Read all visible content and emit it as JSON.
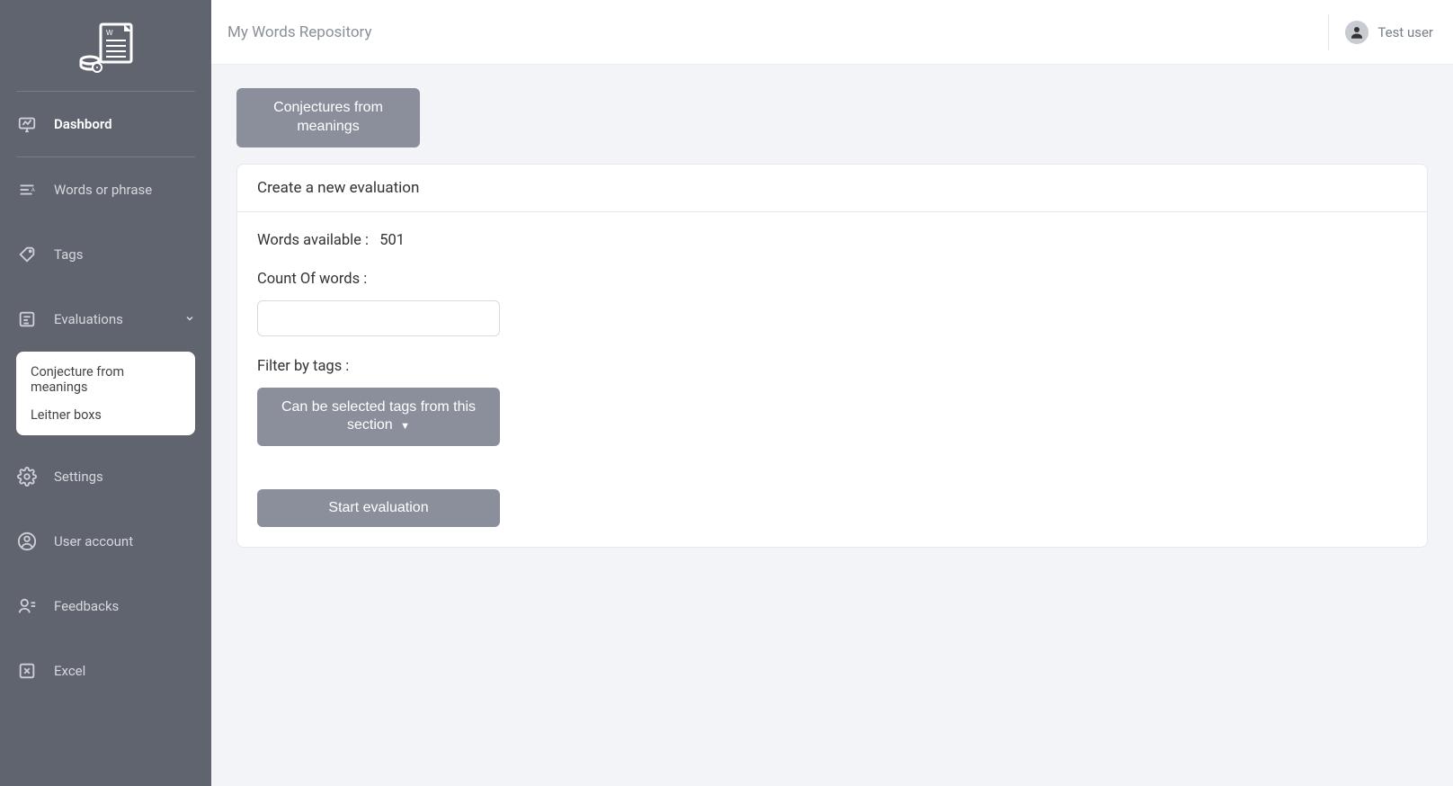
{
  "header": {
    "title": "My Words Repository",
    "user_name": "Test user"
  },
  "sidebar": {
    "items": [
      {
        "label": "Dashbord",
        "icon": "dashboard-icon",
        "active": true
      },
      {
        "label": "Words or phrase",
        "icon": "words-icon"
      },
      {
        "label": "Tags",
        "icon": "tags-icon"
      },
      {
        "label": "Evaluations",
        "icon": "evaluations-icon",
        "has_chevron": true
      },
      {
        "label": "Settings",
        "icon": "settings-icon"
      },
      {
        "label": "User account",
        "icon": "user-icon"
      },
      {
        "label": "Feedbacks",
        "icon": "feedback-icon"
      },
      {
        "label": "Excel",
        "icon": "excel-icon"
      }
    ],
    "submenu": {
      "items": [
        {
          "label": "Conjecture from meanings"
        },
        {
          "label": "Leitner boxs"
        }
      ]
    }
  },
  "tabs": {
    "conjectures_label": "Conjectures from meanings"
  },
  "card": {
    "header": "Create a new evaluation",
    "words_available_label": "Words available :",
    "words_available_value": "501",
    "count_label": "Count Of words :",
    "count_value": "",
    "filter_label": "Filter by tags :",
    "filter_dropdown_label": "Can be selected tags from this section",
    "start_label": "Start evaluation"
  }
}
